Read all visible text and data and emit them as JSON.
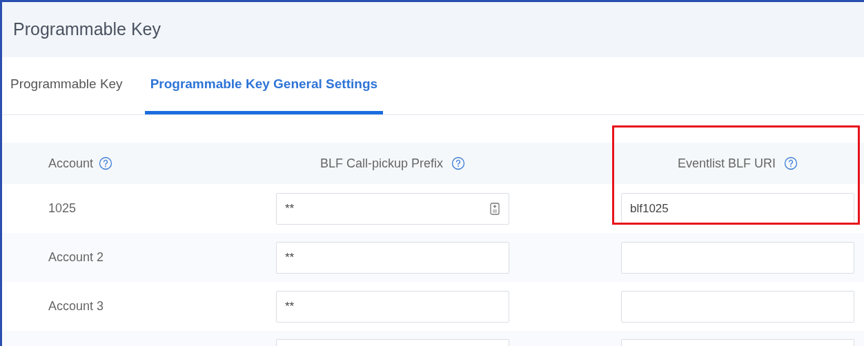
{
  "page_title": "Programmable Key",
  "tabs": [
    {
      "label": "Programmable Key",
      "selected": false
    },
    {
      "label": "Programmable Key General Settings",
      "selected": true
    }
  ],
  "table": {
    "columns": [
      {
        "label": "Account"
      },
      {
        "label": "BLF Call-pickup Prefix"
      },
      {
        "label": "Eventlist BLF URI"
      }
    ],
    "rows": [
      {
        "account": "1025",
        "prefix": "**",
        "uri": "blf1025",
        "autofill_icon": true
      },
      {
        "account": "Account 2",
        "prefix": "**",
        "uri": "",
        "autofill_icon": false
      },
      {
        "account": "Account 3",
        "prefix": "**",
        "uri": "",
        "autofill_icon": false
      }
    ]
  }
}
